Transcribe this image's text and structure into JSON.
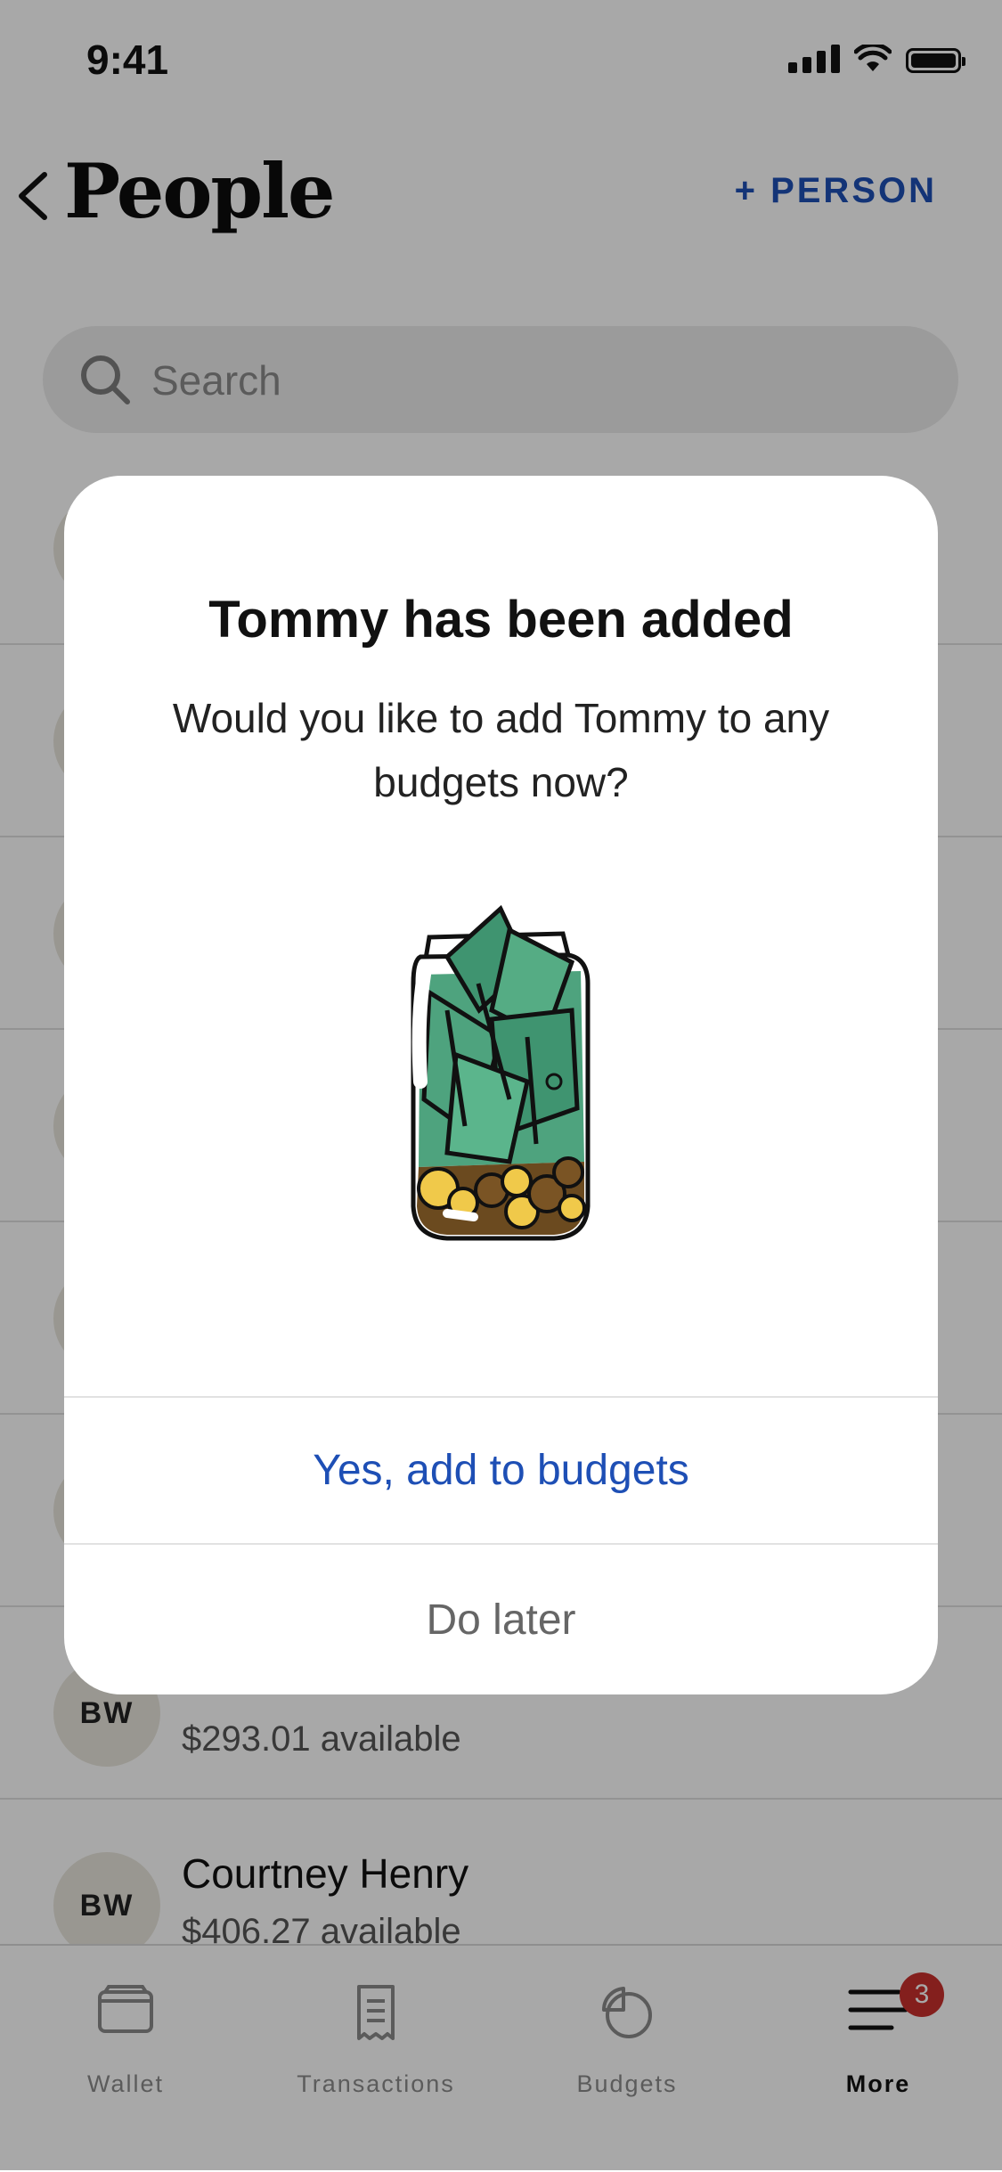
{
  "status_bar": {
    "time": "9:41"
  },
  "header": {
    "title": "People",
    "add_person_label": "+ PERSON"
  },
  "search": {
    "placeholder": "Search"
  },
  "people": [
    {
      "initials": "",
      "name": "",
      "available": ""
    },
    {
      "initials": "",
      "name": "",
      "available": ""
    },
    {
      "initials": "",
      "name": "",
      "available": ""
    },
    {
      "initials": "",
      "name": "",
      "available": ""
    },
    {
      "initials": "",
      "name": "",
      "available": ""
    },
    {
      "initials": "",
      "name": "",
      "available": ""
    },
    {
      "initials": "BW",
      "name": "",
      "available": "$293.01 available"
    },
    {
      "initials": "BW",
      "name": "Courtney Henry",
      "available": "$406.27 available"
    }
  ],
  "tabbar": {
    "tabs": [
      {
        "label": "Wallet",
        "icon": "wallet-icon"
      },
      {
        "label": "Transactions",
        "icon": "receipt-icon"
      },
      {
        "label": "Budgets",
        "icon": "pie-chart-icon"
      },
      {
        "label": "More",
        "icon": "menu-icon",
        "badge": "3",
        "active": true
      }
    ]
  },
  "modal": {
    "title": "Tommy has been added",
    "body": "Would you like to add Tommy to any budgets now?",
    "illustration": "money-jar-icon",
    "primary_action": "Yes, add to budgets",
    "secondary_action": "Do later"
  },
  "colors": {
    "accent": "#1e4fb5",
    "badge": "#c9302c",
    "overlay": "rgba(0,0,0,0.34)",
    "avatar_bg": "#e9e6dc"
  }
}
